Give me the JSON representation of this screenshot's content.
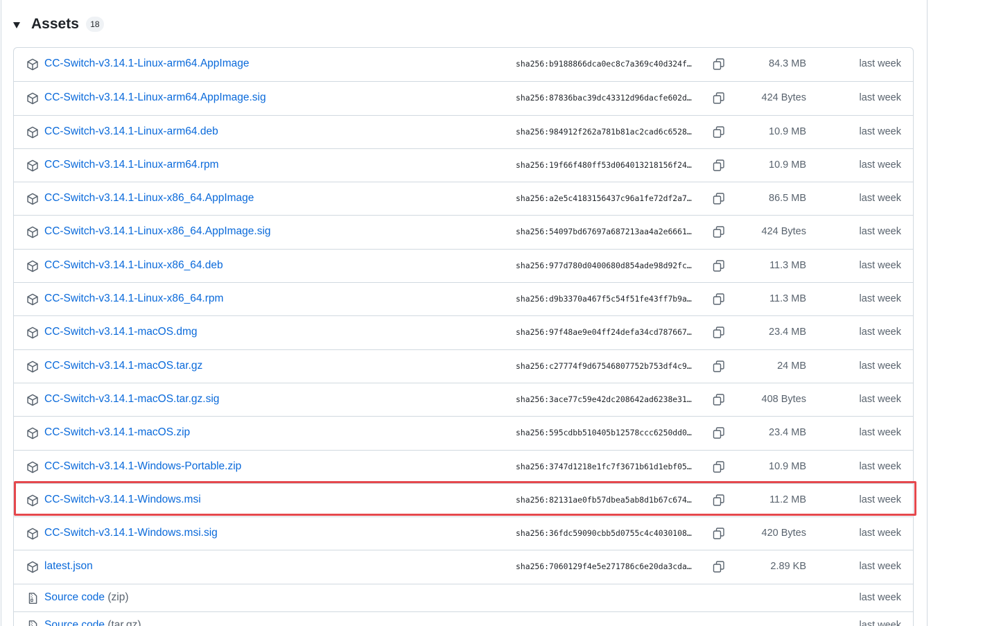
{
  "assets": {
    "title": "Assets",
    "count": "18",
    "highlight_color": "#e5484d",
    "link_color": "#0969da",
    "rows": [
      {
        "name": "CC-Switch-v3.14.1-Linux-arm64.AppImage",
        "sha": "sha256:b9188866dca0ec8c7a369c40d324f…",
        "size": "84.3 MB",
        "date": "last week"
      },
      {
        "name": "CC-Switch-v3.14.1-Linux-arm64.AppImage.sig",
        "sha": "sha256:87836bac39dc43312d96dacfe602d…",
        "size": "424 Bytes",
        "date": "last week"
      },
      {
        "name": "CC-Switch-v3.14.1-Linux-arm64.deb",
        "sha": "sha256:984912f262a781b81ac2cad6c6528…",
        "size": "10.9 MB",
        "date": "last week"
      },
      {
        "name": "CC-Switch-v3.14.1-Linux-arm64.rpm",
        "sha": "sha256:19f66f480ff53d064013218156f24…",
        "size": "10.9 MB",
        "date": "last week"
      },
      {
        "name": "CC-Switch-v3.14.1-Linux-x86_64.AppImage",
        "sha": "sha256:a2e5c4183156437c96a1fe72df2a7…",
        "size": "86.5 MB",
        "date": "last week"
      },
      {
        "name": "CC-Switch-v3.14.1-Linux-x86_64.AppImage.sig",
        "sha": "sha256:54097bd67697a687213aa4a2e6661…",
        "size": "424 Bytes",
        "date": "last week"
      },
      {
        "name": "CC-Switch-v3.14.1-Linux-x86_64.deb",
        "sha": "sha256:977d780d0400680d854ade98d92fc…",
        "size": "11.3 MB",
        "date": "last week"
      },
      {
        "name": "CC-Switch-v3.14.1-Linux-x86_64.rpm",
        "sha": "sha256:d9b3370a467f5c54f51fe43ff7b9a…",
        "size": "11.3 MB",
        "date": "last week"
      },
      {
        "name": "CC-Switch-v3.14.1-macOS.dmg",
        "sha": "sha256:97f48ae9e04ff24defa34cd787667…",
        "size": "23.4 MB",
        "date": "last week"
      },
      {
        "name": "CC-Switch-v3.14.1-macOS.tar.gz",
        "sha": "sha256:c27774f9d67546807752b753df4c9…",
        "size": "24 MB",
        "date": "last week"
      },
      {
        "name": "CC-Switch-v3.14.1-macOS.tar.gz.sig",
        "sha": "sha256:3ace77c59e42dc208642ad6238e31…",
        "size": "408 Bytes",
        "date": "last week"
      },
      {
        "name": "CC-Switch-v3.14.1-macOS.zip",
        "sha": "sha256:595cdbb510405b12578ccc6250dd0…",
        "size": "23.4 MB",
        "date": "last week"
      },
      {
        "name": "CC-Switch-v3.14.1-Windows-Portable.zip",
        "sha": "sha256:3747d1218e1fc7f3671b61d1ebf05…",
        "size": "10.9 MB",
        "date": "last week"
      },
      {
        "name": "CC-Switch-v3.14.1-Windows.msi",
        "sha": "sha256:82131ae0fb57dbea5ab8d1b67c674…",
        "size": "11.2 MB",
        "date": "last week"
      },
      {
        "name": "CC-Switch-v3.14.1-Windows.msi.sig",
        "sha": "sha256:36fdc59090cbb5d0755c4c4030108…",
        "size": "420 Bytes",
        "date": "last week"
      },
      {
        "name": "latest.json",
        "sha": "sha256:7060129f4e5e271786c6e20da3cda…",
        "size": "2.89 KB",
        "date": "last week"
      }
    ],
    "sources": [
      {
        "name": "Source code",
        "format": "(zip)",
        "date": "last week"
      },
      {
        "name": "Source code",
        "format": "(tar.gz)",
        "date": "last week"
      }
    ]
  }
}
